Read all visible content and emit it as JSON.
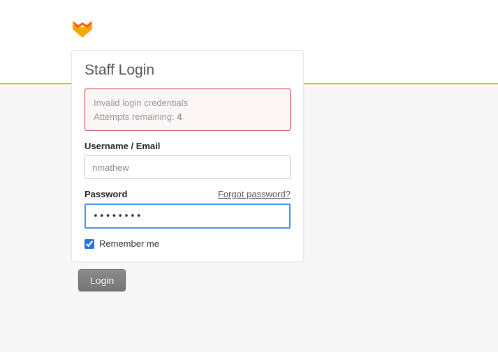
{
  "logo": {
    "name": "fox-logo"
  },
  "card": {
    "title": "Staff Login",
    "error": {
      "line1": "Invalid login credentials",
      "line2_prefix": "Attempts remaining: ",
      "attempts": "4"
    },
    "username": {
      "label": "Username / Email",
      "value": "nmathew"
    },
    "password": {
      "label": "Password",
      "forgot": "Forgot password?",
      "value": "••••••••"
    },
    "remember": {
      "label": "Remember me",
      "checked": true
    }
  },
  "button": {
    "login": "Login"
  }
}
